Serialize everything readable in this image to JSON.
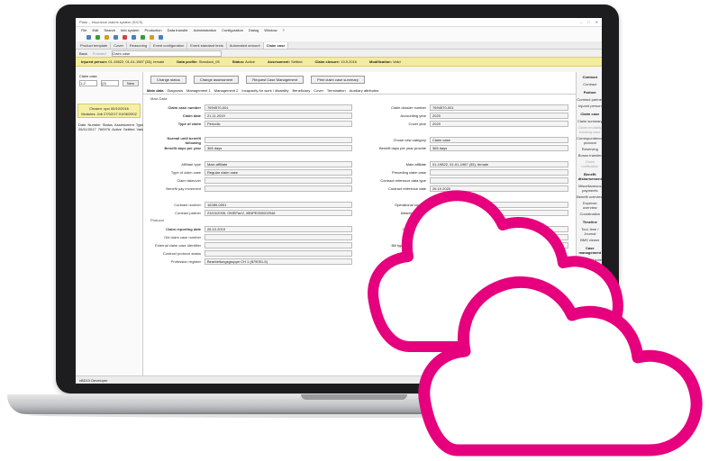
{
  "app": {
    "title": "Plato – Insurance claims system (SICS)",
    "menu": [
      "File",
      "Edit",
      "Search",
      "Info system",
      "Production",
      "Data transfer",
      "Administration",
      "Configuration",
      "Dialog",
      "Window",
      "?"
    ],
    "tabs": [
      {
        "label": "Product template"
      },
      {
        "label": "Cover"
      },
      {
        "label": "Reasoning"
      },
      {
        "label": "Event configuration"
      },
      {
        "label": "Event standard texts"
      },
      {
        "label": "Automated amount"
      },
      {
        "label": "Claim case",
        "active": true
      }
    ],
    "nav": {
      "back": "Back",
      "forward": "Forward",
      "location": "Claim case"
    },
    "infobar": {
      "insured_label": "Injured person:",
      "insured_value": "01-19822, 01-01-1987 (35), female",
      "profile_label": "Data profile:",
      "profile_value": "Standard_05",
      "status_label": "Status:",
      "status_value": "Active",
      "assessment_label": "Assessment:",
      "assessment_value": "Settled",
      "closure_label": "Claim closure:",
      "closure_value": "19.5.2016",
      "modification_label": "Modification:",
      "modification_value": "Valid"
    },
    "status_bar": "vBD10 Developer"
  },
  "left_panel": {
    "title": "Claim case",
    "field1": "1-2",
    "field2": "(2)",
    "new_button": "New",
    "card_line1": "Chosen: upo 00/10/2016",
    "card_line2": "Modules: Job 27/02/17 01/06/2002",
    "table": {
      "headers": [
        "Date",
        "Number",
        "Status",
        "Assessment",
        "Type"
      ],
      "rows": [
        [
          "26/11/2017",
          "760976",
          "Active",
          "Settled",
          "Variable"
        ]
      ]
    }
  },
  "center": {
    "buttons": [
      "Change status",
      "Change assessment",
      "Request Case Management",
      "Print claim case summary"
    ],
    "subtabs": [
      "Main data",
      "Diagnosis",
      "Management 1",
      "Management 2",
      "Incapacity for work / disability",
      "Beneficiary",
      "Cover",
      "Termination",
      "Auxiliary attributes"
    ],
    "section_main": "Main Data",
    "section_protocol": "Protocol",
    "left_fields": [
      {
        "label": "Claim case number",
        "value": "7694570-001",
        "bold": true
      },
      {
        "label": "Claim date",
        "value": "21.11.2019",
        "bold": true
      },
      {
        "label": "Type of claim",
        "value": "Periodic",
        "bold": true
      },
      {
        "label": "",
        "value": ""
      },
      {
        "label": "Normal until benefit following",
        "value": "",
        "bold": true
      },
      {
        "label": "Benefit days per year",
        "value": "365 days",
        "bold": true
      },
      {
        "label": "",
        "value": ""
      },
      {
        "label": "Affiliate type",
        "value": "Main affiliate"
      },
      {
        "label": "Type of claim case",
        "value": "Regular claim case"
      },
      {
        "label": "Claim takeover",
        "value": ""
      },
      {
        "label": "Benefit pay increment",
        "value": ""
      },
      {
        "label": "",
        "value": ""
      },
      {
        "label": "Contract number",
        "value": "16289-0001"
      },
      {
        "label": "Contract partner",
        "value": "23/10/2005, OMEPacV, 45NPE000002946"
      }
    ],
    "right_fields": [
      {
        "label": "Claim dossier number",
        "value": "7694570-001"
      },
      {
        "label": "Accounting year",
        "value": "2020"
      },
      {
        "label": "Cover year",
        "value": "2020"
      },
      {
        "label": "",
        "value": ""
      },
      {
        "label": "Chose new category",
        "value": "Claim case",
        "bold": true
      },
      {
        "label": "Benefit days per year provide",
        "value": "365 days",
        "bold": true
      },
      {
        "label": "",
        "value": ""
      },
      {
        "label": "Main affiliate",
        "value": "01-19822, 01-01-1987 (35), female"
      },
      {
        "label": "Preceding claim case",
        "value": ""
      },
      {
        "label": "Contract reference data type",
        "value": ""
      },
      {
        "label": "Contract reference date",
        "value": "26.10.2020"
      },
      {
        "label": "",
        "value": ""
      },
      {
        "label": "Operational country",
        "value": ""
      },
      {
        "label": "Attached carrier",
        "value": ""
      }
    ],
    "protocol_left": [
      {
        "label": "Claim reporting date",
        "value": "26.10.2019",
        "bold": true
      },
      {
        "label": "Old claim case number",
        "value": ""
      },
      {
        "label": "External claim case identifier",
        "value": ""
      },
      {
        "label": "Contract protocol status",
        "value": ""
      },
      {
        "label": "Profession register",
        "value": "Bearbeitungsgruppe CH 1 (879051-5)"
      }
    ],
    "protocol_right": [
      {
        "label": "Cause of claim",
        "value": ""
      },
      {
        "label": "Permission",
        "value": ""
      },
      {
        "label": "Bill type requirements",
        "value": ""
      }
    ],
    "protocol_link": "Protocol"
  },
  "right_panel": [
    {
      "section": "Contract",
      "items": [
        {
          "label": "Contract"
        }
      ]
    },
    {
      "section": "Partner",
      "items": [
        {
          "label": "Contract partner"
        },
        {
          "label": "Injured person"
        }
      ]
    },
    {
      "section": "Claim case",
      "items": [
        {
          "label": "Claim summary"
        },
        {
          "label": "Claim modality tracking case",
          "dim": true
        },
        {
          "label": "Correspondence protocol"
        },
        {
          "label": "Reserving"
        },
        {
          "label": "Bonus transfer"
        },
        {
          "label": "Claim notification",
          "dim": true
        }
      ]
    },
    {
      "section": "Benefit disbursement",
      "items": [
        {
          "label": "Miscellaneous payments"
        },
        {
          "label": "Benefit overview"
        },
        {
          "label": "Expense overview"
        },
        {
          "label": "Coordination"
        }
      ]
    },
    {
      "section": "Timeline",
      "items": [
        {
          "label": "Tool, time / Journal"
        },
        {
          "label": "BMS viewer"
        }
      ]
    },
    {
      "section": "Case management",
      "items": [
        {
          "label": "Open CM note"
        }
      ]
    },
    {
      "section": "Approval system",
      "items": [
        {
          "label": "Approval protocol"
        }
      ]
    }
  ],
  "colors": {
    "cloud": "#e6007e",
    "infobar": "#f3ec9c",
    "laptop": "#1d1d1f"
  }
}
